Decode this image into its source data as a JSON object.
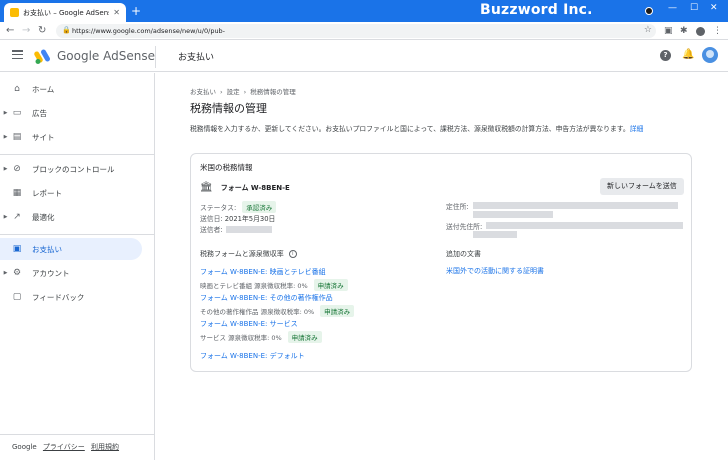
{
  "browser": {
    "tab_title": "お支払い – Google AdSense",
    "url": "https://www.google.com/adsense/new/u/0/pub-",
    "watermark": "Buzzword Inc."
  },
  "header": {
    "brand": "Google AdSense",
    "title": "お支払い"
  },
  "sidebar": {
    "items": [
      {
        "label": "ホーム",
        "icon": "home-icon"
      },
      {
        "label": "広告",
        "icon": "ads-icon"
      },
      {
        "label": "サイト",
        "icon": "sites-icon"
      },
      {
        "label": "ブロックのコントロール",
        "icon": "block-icon"
      },
      {
        "label": "レポート",
        "icon": "report-icon"
      },
      {
        "label": "最適化",
        "icon": "trend-icon"
      },
      {
        "label": "お支払い",
        "icon": "payment-icon"
      },
      {
        "label": "アカウント",
        "icon": "gear-icon"
      },
      {
        "label": "フィードバック",
        "icon": "feedback-icon"
      }
    ],
    "footer": {
      "brand": "Google",
      "privacy": "プライバシー",
      "terms": "利用規約"
    }
  },
  "main": {
    "breadcrumb": [
      "お支払い",
      "設定",
      "税務情報の管理"
    ],
    "title": "税務情報の管理",
    "description": "税務情報を入力するか、更新してください。お支払いプロファイルと国によって、課税方法、源泉徴収税額の計算方法、申告方法が異なります。",
    "description_link": "詳細",
    "card": {
      "title": "米国の税務情報",
      "form_name": "フォーム W-8BEN-E",
      "submit_button": "新しいフォームを送信",
      "status_label": "ステータス:",
      "status_value": "承認済み",
      "submitted_label": "送信日:",
      "submitted_value": "2021年5月30日",
      "submitter_label": "送信者:",
      "address_label": "定住所:",
      "mailing_label": "送付先住所:",
      "treaty_heading": "税務フォームと源泉徴収率",
      "docs_heading": "追加の文書",
      "docs_link": "米国外での活動に関する証明書",
      "treaties": [
        {
          "link": "フォーム W-8BEN-E: 映画とテレビ番組",
          "sub": "映画とテレビ番組 源泉徴収税率: 0%",
          "badge": "申請済み"
        },
        {
          "link": "フォーム W-8BEN-E: その他の著作権作品",
          "sub": "その他の著作権作品 源泉徴収税率: 0%",
          "badge": "申請済み"
        },
        {
          "link": "フォーム W-8BEN-E: サービス",
          "sub": "サービス 源泉徴収税率: 0%",
          "badge": "申請済み"
        },
        {
          "link": "フォーム W-8BEN-E: デフォルト"
        }
      ]
    }
  }
}
